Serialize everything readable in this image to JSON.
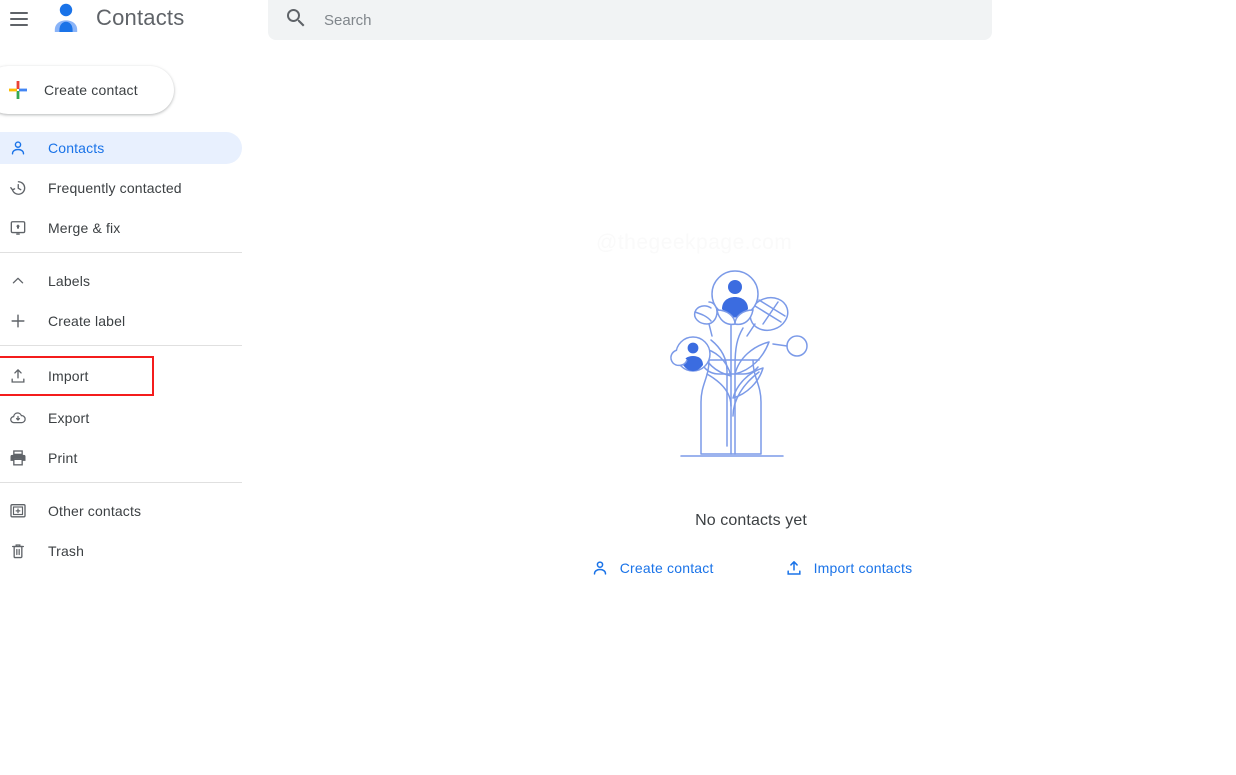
{
  "header": {
    "menu_icon": "hamburger-menu-icon",
    "logo_icon": "google-contacts-person-logo",
    "title": "Contacts",
    "search": {
      "icon": "search-icon",
      "placeholder": "Search",
      "value": ""
    }
  },
  "sidebar": {
    "create_button": {
      "label": "Create contact",
      "icon": "multicolor-plus-icon"
    },
    "groups": [
      {
        "items": [
          {
            "label": "Contacts",
            "icon": "person-icon",
            "selected": true
          },
          {
            "label": "Frequently contacted",
            "icon": "history-clock-icon",
            "selected": false
          },
          {
            "label": "Merge & fix",
            "icon": "merge-box-icon",
            "selected": false
          }
        ]
      },
      {
        "items": [
          {
            "label": "Labels",
            "icon": "chevron-up-icon",
            "selected": false
          },
          {
            "label": "Create label",
            "icon": "plus-icon",
            "selected": false
          }
        ]
      },
      {
        "items": [
          {
            "label": "Import",
            "icon": "upload-icon",
            "selected": false,
            "highlighted": true
          },
          {
            "label": "Export",
            "icon": "cloud-download-icon",
            "selected": false
          },
          {
            "label": "Print",
            "icon": "printer-icon",
            "selected": false
          }
        ]
      },
      {
        "items": [
          {
            "label": "Other contacts",
            "icon": "other-contacts-box-icon",
            "selected": false
          },
          {
            "label": "Trash",
            "icon": "trash-icon",
            "selected": false
          }
        ]
      }
    ]
  },
  "main": {
    "illustration": "flowers-in-vase-illustration",
    "watermark": "@thegeekpage.com",
    "empty_title": "No contacts yet",
    "actions": [
      {
        "label": "Create contact",
        "icon": "person-icon"
      },
      {
        "label": "Import contacts",
        "icon": "upload-icon"
      }
    ]
  },
  "colors": {
    "accent_blue": "#1a73e8",
    "selected_pill": "#e8f0fe",
    "highlight_red": "#f41c1c",
    "search_bg": "#f1f3f4",
    "text_primary": "#3c4043",
    "icon_gray": "#5f6368"
  }
}
